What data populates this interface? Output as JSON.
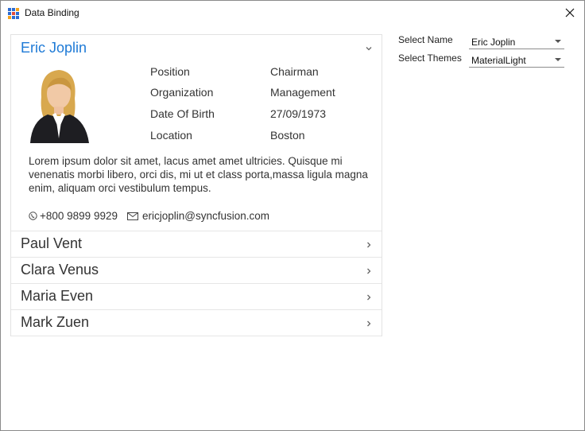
{
  "window": {
    "title": "Data Binding",
    "close_symbol": "✕"
  },
  "accordion": {
    "expanded": {
      "name": "Eric Joplin",
      "details": [
        {
          "label": "Position",
          "value": "Chairman"
        },
        {
          "label": "Organization",
          "value": "Management"
        },
        {
          "label": "Date Of Birth",
          "value": "27/09/1973"
        },
        {
          "label": "Location",
          "value": "Boston"
        }
      ],
      "description": "Lorem ipsum dolor sit amet, lacus amet amet ultricies. Quisque mi venenatis morbi libero, orci dis, mi ut et class porta,massa ligula magna enim, aliquam orci vestibulum tempus.",
      "phone": "+800 9899 9929",
      "email": "ericjoplin@syncfusion.com"
    },
    "collapsed_items": [
      {
        "name": "Paul Vent"
      },
      {
        "name": "Clara Venus"
      },
      {
        "name": "Maria Even"
      },
      {
        "name": "Mark Zuen"
      }
    ]
  },
  "properties": {
    "select_name_label": "Select Name",
    "select_name_value": "Eric Joplin",
    "select_themes_label": "Select Themes",
    "select_themes_value": "MaterialLight"
  },
  "colors": {
    "accent": "#1e7ad6",
    "border": "#e2e2e2"
  }
}
